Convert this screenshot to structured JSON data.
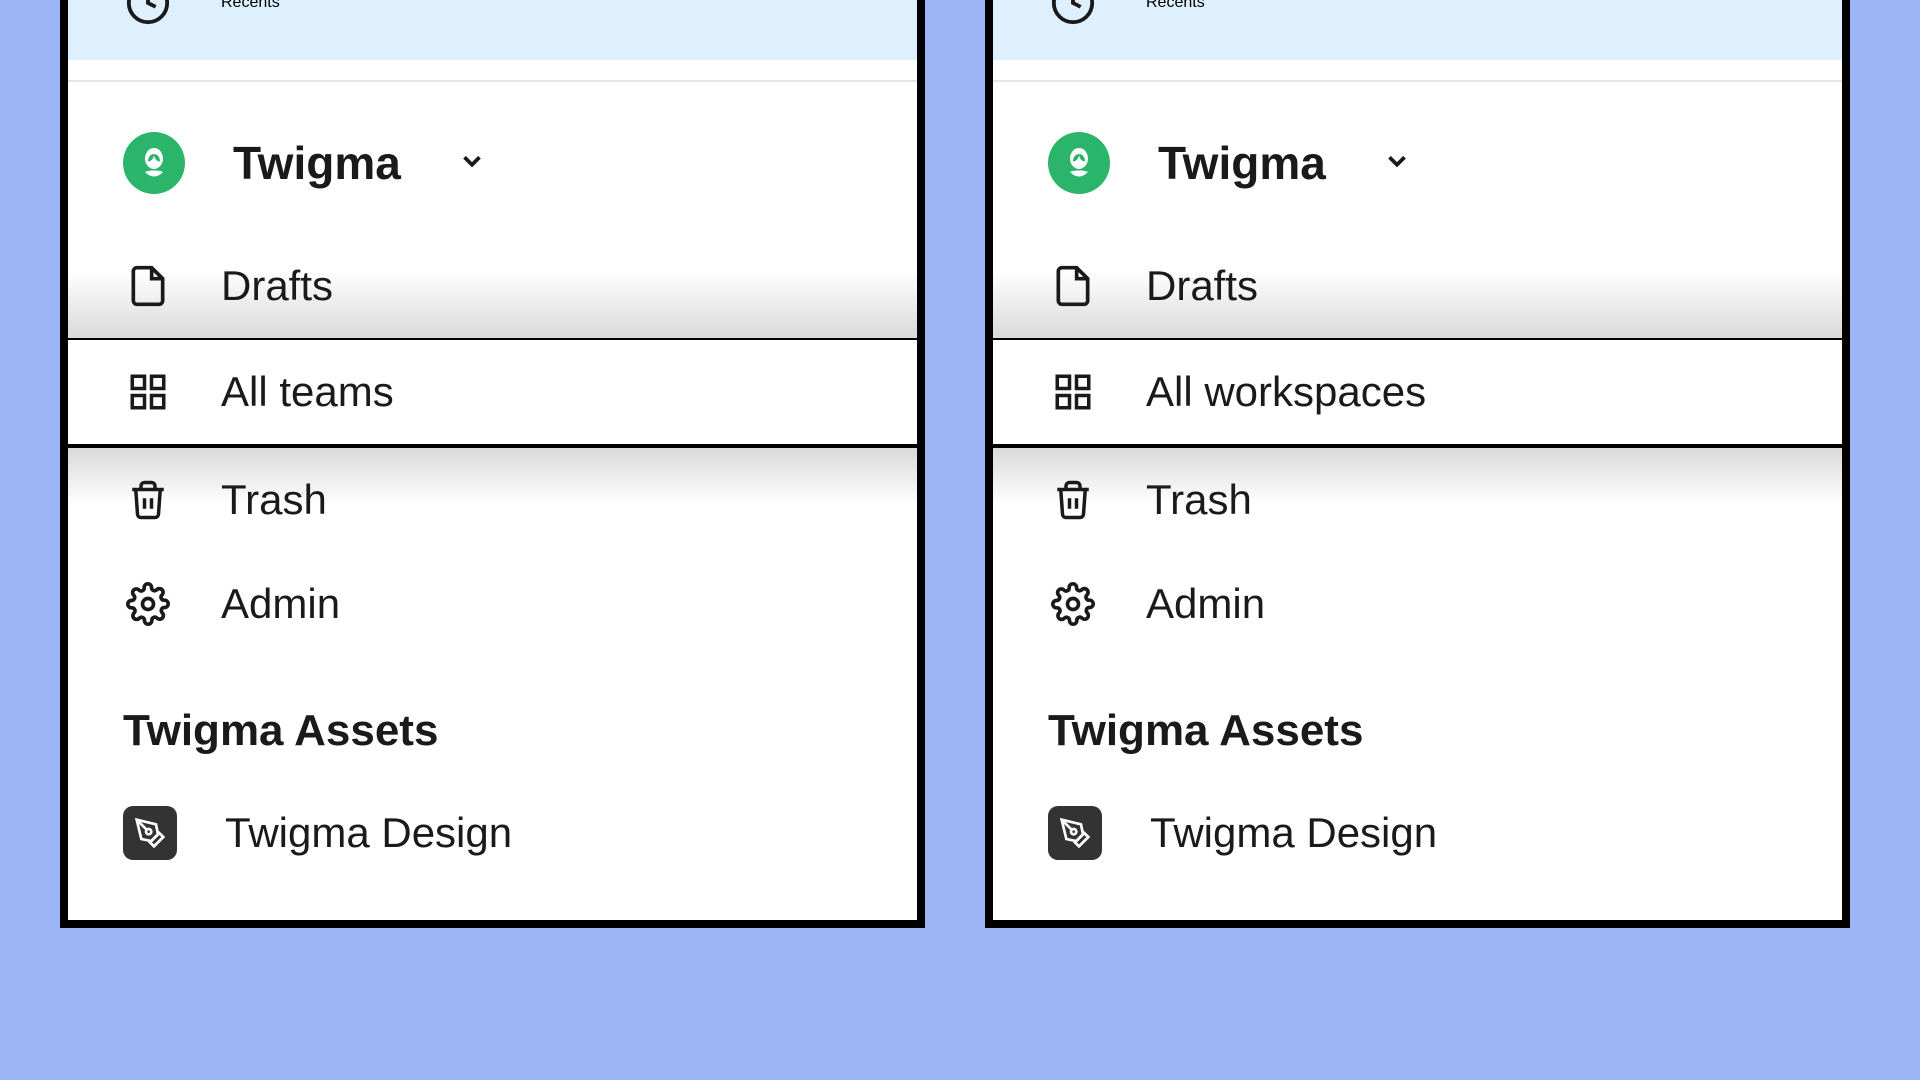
{
  "recents_label": "Recents",
  "org_name": "Twigma",
  "left": {
    "items": [
      "Drafts",
      "All teams",
      "Trash",
      "Admin"
    ]
  },
  "right": {
    "items": [
      "Drafts",
      "All workspaces",
      "Trash",
      "Admin"
    ]
  },
  "assets_header": "Twigma Assets",
  "asset_item": "Twigma Design",
  "colors": {
    "bg": "#9db4f5",
    "recents_bg": "#def0fd",
    "org_badge": "#2ab56a",
    "asset_badge": "#333333"
  }
}
